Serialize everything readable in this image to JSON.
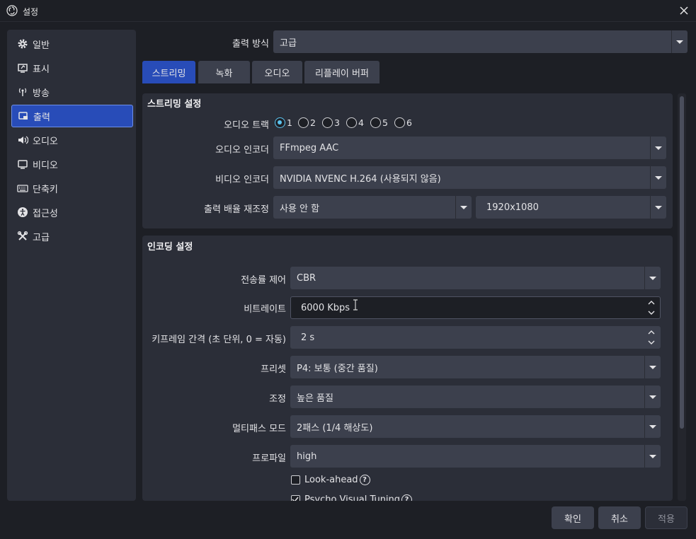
{
  "window": {
    "title": "설정"
  },
  "sidebar": {
    "items": [
      {
        "label": "일반",
        "icon": "gear-icon"
      },
      {
        "label": "표시",
        "icon": "display-icon"
      },
      {
        "label": "방송",
        "icon": "broadcast-icon"
      },
      {
        "label": "출력",
        "icon": "output-icon",
        "active": true
      },
      {
        "label": "오디오",
        "icon": "speaker-icon"
      },
      {
        "label": "비디오",
        "icon": "monitor-icon"
      },
      {
        "label": "단축키",
        "icon": "keyboard-icon"
      },
      {
        "label": "접근성",
        "icon": "accessibility-icon"
      },
      {
        "label": "고급",
        "icon": "tools-icon"
      }
    ]
  },
  "output_mode": {
    "label": "출력 방식",
    "value": "고급"
  },
  "tabs": [
    {
      "label": "스트리밍",
      "active": true
    },
    {
      "label": "녹화"
    },
    {
      "label": "오디오"
    },
    {
      "label": "리플레이 버퍼"
    }
  ],
  "streaming": {
    "title": "스트리밍 설정",
    "audio_track": {
      "label": "오디오 트랙",
      "options": [
        "1",
        "2",
        "3",
        "4",
        "5",
        "6"
      ],
      "selected": "1"
    },
    "audio_encoder": {
      "label": "오디오 인코더",
      "value": "FFmpeg AAC"
    },
    "video_encoder": {
      "label": "비디오 인코더",
      "value": "NVIDIA NVENC H.264 (사용되지 않음)"
    },
    "rescale": {
      "label": "출력 배율 재조정",
      "value": "사용 안 함",
      "resolution": "1920x1080"
    }
  },
  "encoding": {
    "title": "인코딩 설정",
    "rate_control": {
      "label": "전송률 제어",
      "value": "CBR"
    },
    "bitrate": {
      "label": "비트레이트",
      "value": "6000 Kbps"
    },
    "keyframe": {
      "label": "키프레임 간격 (초 단위, 0 = 자동)",
      "value": "2 s"
    },
    "preset": {
      "label": "프리셋",
      "value": "P4: 보통 (중간 품질)"
    },
    "tuning": {
      "label": "조정",
      "value": "높은 품질"
    },
    "multipass": {
      "label": "멀티패스 모드",
      "value": "2패스 (1/4 해상도)"
    },
    "profile": {
      "label": "프로파일",
      "value": "high"
    },
    "lookahead": {
      "label": "Look-ahead",
      "checked": false
    },
    "psycho": {
      "label": "Psycho Visual Tuning",
      "checked": true
    }
  },
  "buttons": {
    "ok": "확인",
    "cancel": "취소",
    "apply": "적용"
  },
  "colors": {
    "accent": "#284cb8",
    "radio_accent": "#5cc4f0"
  }
}
